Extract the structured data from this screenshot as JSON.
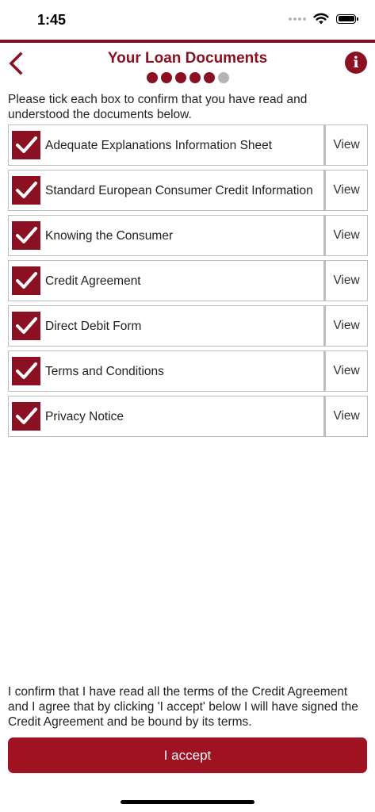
{
  "status_bar": {
    "time": "1:45"
  },
  "header": {
    "title": "Your Loan Documents",
    "progress": {
      "total_steps": 6,
      "completed_steps": 5
    },
    "info_label": "i"
  },
  "instruction": "Please tick each box to confirm that you have read and understood the documents below.",
  "documents": [
    {
      "label": "Adequate Explanations Information Sheet",
      "checked": true,
      "view_label": "View"
    },
    {
      "label": "Standard European Consumer Credit Information",
      "checked": true,
      "view_label": "View"
    },
    {
      "label": "Knowing the Consumer",
      "checked": true,
      "view_label": "View"
    },
    {
      "label": "Credit Agreement",
      "checked": true,
      "view_label": "View"
    },
    {
      "label": "Direct Debit Form",
      "checked": true,
      "view_label": "View"
    },
    {
      "label": "Terms and Conditions",
      "checked": true,
      "view_label": "View"
    },
    {
      "label": "Privacy Notice",
      "checked": true,
      "view_label": "View"
    }
  ],
  "confirmation_text": "I confirm that I have read all the terms of the Credit Agreement and I agree that by clicking 'I accept' below I will have signed the Credit Agreement and be bound by its terms.",
  "accept_button_label": "I accept",
  "colors": {
    "brand": "#8a1022",
    "button": "#9e1222",
    "dot_active": "#8a1022",
    "dot_inactive": "#b4b4b4"
  }
}
